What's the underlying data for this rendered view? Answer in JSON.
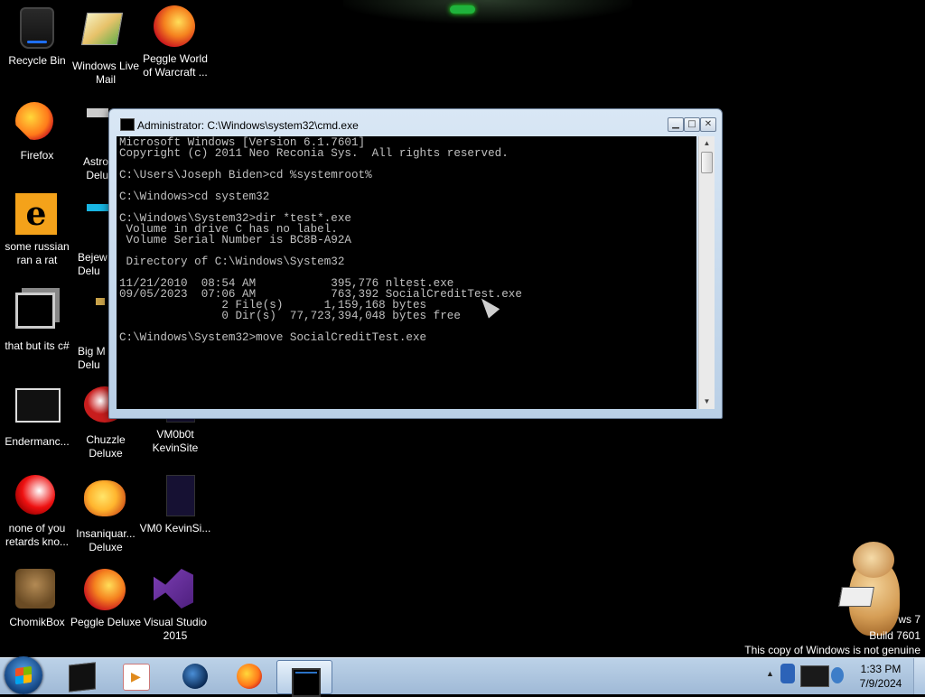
{
  "desktop": {
    "icons": [
      {
        "label": "Recycle Bin",
        "icon": "recycle-bin-icon"
      },
      {
        "label": "Windows Live Mail",
        "icon": "windows-live-mail-icon"
      },
      {
        "label": "Peggle World of Warcraft ...",
        "icon": "peggle-icon"
      },
      {
        "label": "Firefox",
        "icon": "firefox-icon"
      },
      {
        "label": "Astro Delu",
        "icon": "astro-icon"
      },
      {
        "label": "some russian ran a rat",
        "icon": "file-e-icon"
      },
      {
        "label": "Bejew Delu",
        "icon": "bejeweled-icon"
      },
      {
        "label": "that but its c#",
        "icon": "shortcut-icon"
      },
      {
        "label": "Big M Delu",
        "icon": "game-icon"
      },
      {
        "label": "Endermanc...",
        "icon": "terminal-icon"
      },
      {
        "label": "Chuzzle Deluxe",
        "icon": "chuzzle-icon"
      },
      {
        "label": "VM0b0t KevinSite",
        "icon": "vm-icon"
      },
      {
        "label": "none of you retards kno...",
        "icon": "ball-icon"
      },
      {
        "label": "Insaniquar... Deluxe",
        "icon": "insaniquarium-icon"
      },
      {
        "label": "VM0 KevinSi...",
        "icon": "vm-icon"
      },
      {
        "label": "ChomikBox",
        "icon": "chomikbox-icon"
      },
      {
        "label": "Peggle Deluxe",
        "icon": "peggle-icon"
      },
      {
        "label": "Visual Studio 2015",
        "icon": "visual-studio-icon"
      }
    ]
  },
  "cmd_window": {
    "title": "Administrator: C:\\Windows\\system32\\cmd.exe",
    "buttons": {
      "minimize": "▁",
      "maximize": "□",
      "close": "✕"
    },
    "lines": [
      "Microsoft Windows [Version 6.1.7601]",
      "Copyright (c) 2011 Neo Reconia Sys.  All rights reserved.",
      "",
      "C:\\Users\\Joseph Biden>cd %systemroot%",
      "",
      "C:\\Windows>cd system32",
      "",
      "C:\\Windows\\System32>dir *test*.exe",
      " Volume in drive C has no label.",
      " Volume Serial Number is BC8B-A92A",
      "",
      " Directory of C:\\Windows\\System32",
      "",
      "11/21/2010  08:54 AM           395,776 nltest.exe",
      "09/05/2023  07:06 AM           763,392 SocialCreditTest.exe",
      "               2 File(s)      1,159,168 bytes",
      "               0 Dir(s)  77,723,394,048 bytes free",
      "",
      "C:\\Windows\\System32>move SocialCreditTest.exe"
    ]
  },
  "watermark": {
    "line1": "ws 7",
    "line2": "Build 7601",
    "line3": "This copy of Windows is not genuine"
  },
  "taskbar": {
    "items": [
      "vmware-icon",
      "media-player-icon",
      "globe-icon",
      "firefox-icon",
      "cmd-icon"
    ],
    "clock": {
      "time": "1:33 PM",
      "date": "7/9/2024"
    }
  }
}
